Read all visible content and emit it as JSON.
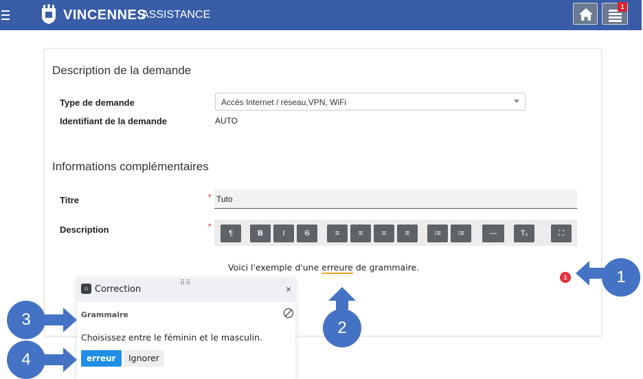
{
  "header": {
    "brand": "VINCENNES",
    "subtitle": "ASSISTANCE",
    "notification_count": "1",
    "colors": {
      "bar": "#3a5da8",
      "badge": "#d9232e"
    }
  },
  "form": {
    "section1_title": "Description de la demande",
    "type_label": "Type de demande",
    "type_value": "Accès Internet / réseau,VPN, WiFi",
    "id_label": "Identifiant de la demande",
    "id_value": "AUTO",
    "section2_title": "Informations complémentaires",
    "title_label": "Titre",
    "title_value": "Tuto",
    "description_label": "Description",
    "required_mark": "*"
  },
  "editor": {
    "toolbar": [
      {
        "icon": "paragraph-icon",
        "glyph": "¶"
      },
      {
        "icon": "bold-icon",
        "glyph": "B"
      },
      {
        "icon": "italic-icon",
        "glyph": "I"
      },
      {
        "icon": "strikethrough-icon",
        "glyph": "S"
      },
      {
        "icon": "align-left-icon",
        "glyph": "≡"
      },
      {
        "icon": "align-center-icon",
        "glyph": "≡"
      },
      {
        "icon": "align-right-icon",
        "glyph": "≡"
      },
      {
        "icon": "justify-icon",
        "glyph": "≡"
      },
      {
        "icon": "bullet-list-icon",
        "glyph": "⁝≡"
      },
      {
        "icon": "numbered-list-icon",
        "glyph": "⁝≡"
      },
      {
        "icon": "horizontal-rule-icon",
        "glyph": "—"
      },
      {
        "icon": "clear-format-icon",
        "glyph": "Tₓ"
      },
      {
        "icon": "fullscreen-icon",
        "glyph": "⛶"
      }
    ],
    "text_before": "Voici l'exemple d'une ",
    "error_word": "erreure",
    "text_after": " de grammaire.",
    "error_count": "1"
  },
  "correction": {
    "title": "Correction",
    "close": "×",
    "category": "Grammaire",
    "message": "Choisissez entre le féminin et le masculin.",
    "suggestion": "erreur",
    "ignore": "Ignorer"
  },
  "annotations": [
    "1",
    "2",
    "3",
    "4"
  ]
}
